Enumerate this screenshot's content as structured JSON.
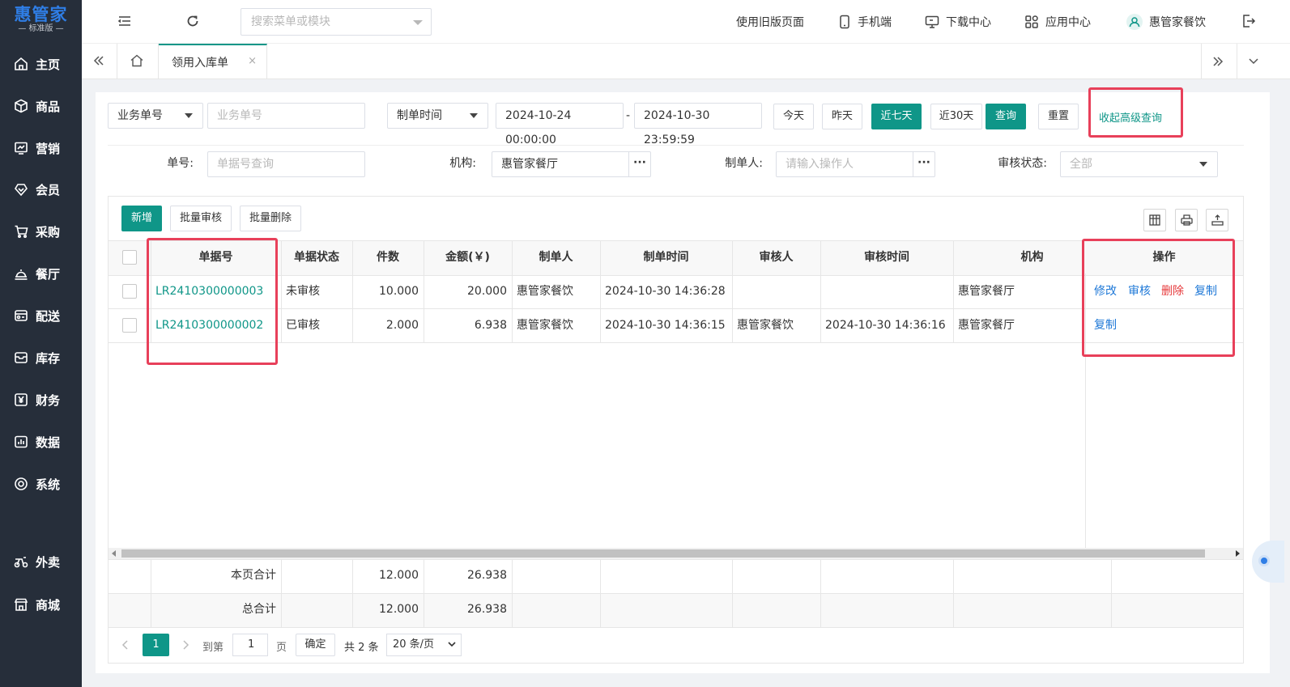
{
  "brand": {
    "title": "惠管家",
    "subtitle": "— 标准版 —",
    "accent": "#0f9688"
  },
  "sidebar": {
    "items": [
      {
        "label": "主页",
        "icon": "home-icon"
      },
      {
        "label": "商品",
        "icon": "box-icon"
      },
      {
        "label": "营销",
        "icon": "chart-icon"
      },
      {
        "label": "会员",
        "icon": "diamond-icon"
      },
      {
        "label": "采购",
        "icon": "cart-icon"
      },
      {
        "label": "餐厅",
        "icon": "cloche-icon"
      },
      {
        "label": "配送",
        "icon": "truck-icon"
      },
      {
        "label": "库存",
        "icon": "inbox-icon"
      },
      {
        "label": "财务",
        "icon": "yen-icon"
      },
      {
        "label": "数据",
        "icon": "data-icon"
      },
      {
        "label": "系统",
        "icon": "settings-icon"
      },
      {
        "label": "外卖",
        "icon": "scooter-icon"
      },
      {
        "label": "商城",
        "icon": "shop-icon"
      }
    ]
  },
  "header": {
    "search_placeholder": "搜索菜单或模块",
    "old_page": "使用旧版页面",
    "mobile": "手机端",
    "download": "下载中心",
    "apps": "应用中心",
    "user": "惠管家餐饮"
  },
  "tabs": {
    "active": "领用入库单",
    "close": "×"
  },
  "filters": {
    "biz_no_select": "业务单号",
    "biz_no_placeholder": "业务单号",
    "time_select": "制单时间",
    "date_start": "2024-10-24 00:00:00",
    "date_sep": "-",
    "date_end": "2024-10-30 23:59:59",
    "today": "今天",
    "yesterday": "昨天",
    "last7": "近七天",
    "last30": "近30天",
    "query": "查询",
    "reset": "重置",
    "collapse": "收起高级查询",
    "doc_no_label": "单号:",
    "doc_no_placeholder": "单据号查询",
    "org_label": "机构:",
    "org_value": "惠管家餐厅",
    "maker_label": "制单人:",
    "maker_placeholder": "请输入操作人",
    "audit_label": "审核状态:",
    "audit_value": "全部",
    "more": "···"
  },
  "toolbar": {
    "add": "新增",
    "batch_audit": "批量审核",
    "batch_delete": "批量删除"
  },
  "table": {
    "headers": {
      "no": "单据号",
      "status": "单据状态",
      "qty": "件数",
      "amount": "金额(￥)",
      "maker": "制单人",
      "make_time": "制单时间",
      "auditor": "审核人",
      "audit_time": "审核时间",
      "org": "机构",
      "ops": "操作"
    },
    "rows": [
      {
        "no": "LR2410300000003",
        "status": "未审核",
        "qty": "10.000",
        "amount": "20.000",
        "maker": "惠管家餐饮",
        "make_time": "2024-10-30 14:36:28",
        "auditor": "",
        "audit_time": "",
        "org": "惠管家餐厅",
        "ops": [
          "修改",
          "审核",
          "删除",
          "复制"
        ]
      },
      {
        "no": "LR2410300000002",
        "status": "已审核",
        "qty": "2.000",
        "amount": "6.938",
        "maker": "惠管家餐饮",
        "make_time": "2024-10-30 14:36:15",
        "auditor": "惠管家餐饮",
        "audit_time": "2024-10-30 14:36:16",
        "org": "惠管家餐厅",
        "ops": [
          "复制"
        ]
      }
    ],
    "page_total": {
      "label": "本页合计",
      "qty": "12.000",
      "amount": "26.938"
    },
    "grand_total": {
      "label": "总合计",
      "qty": "12.000",
      "amount": "26.938"
    }
  },
  "pager": {
    "current": "1",
    "goto_label": "到第",
    "goto_value": "1",
    "page_unit": "页",
    "confirm": "确定",
    "total": "共 2 条",
    "size": "20 条/页"
  }
}
